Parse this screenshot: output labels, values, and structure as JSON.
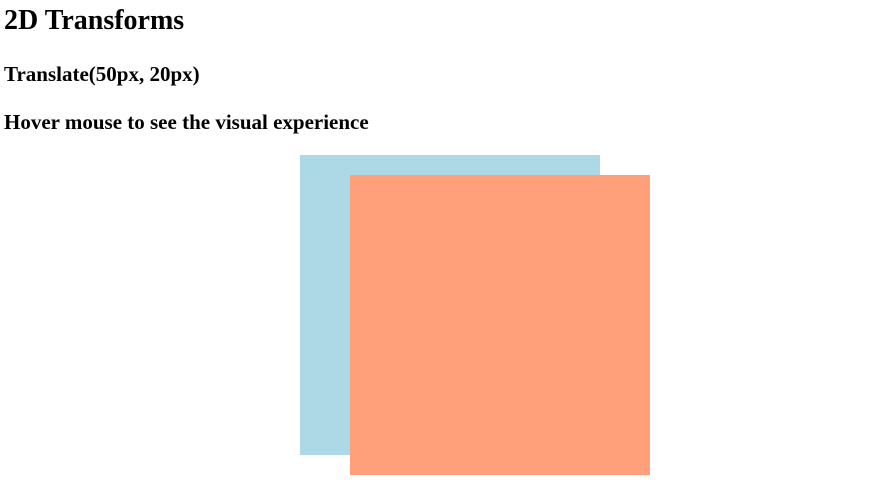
{
  "heading": {
    "title": "2D Transforms",
    "subtitle": "Translate(50px, 20px)",
    "instruction": "Hover mouse to see the visual experience"
  },
  "colors": {
    "original_box": "#add8e6",
    "translated_box": "#ffa07a",
    "background": "#ffffff",
    "text": "#000000"
  }
}
